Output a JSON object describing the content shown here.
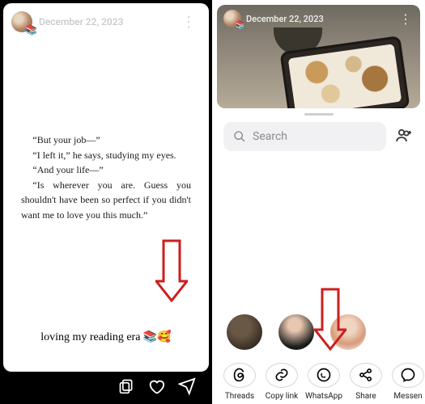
{
  "left": {
    "date": "December 22, 2023",
    "text": {
      "p1": "“But your job—”",
      "p2": "“I left it,” he says, studying my eyes.",
      "p3": "“And your life—”",
      "p4": "“Is wherever you are. Guess you shouldn't have been so perfect if you didn't want me to love you this much.”"
    },
    "caption": "loving my reading era 📚🥰"
  },
  "right": {
    "date": "December 22, 2023",
    "search_placeholder": "Search",
    "share": [
      {
        "label": "Threads"
      },
      {
        "label": "Copy link"
      },
      {
        "label": "WhatsApp"
      },
      {
        "label": "Share"
      },
      {
        "label": "Messen"
      }
    ]
  }
}
